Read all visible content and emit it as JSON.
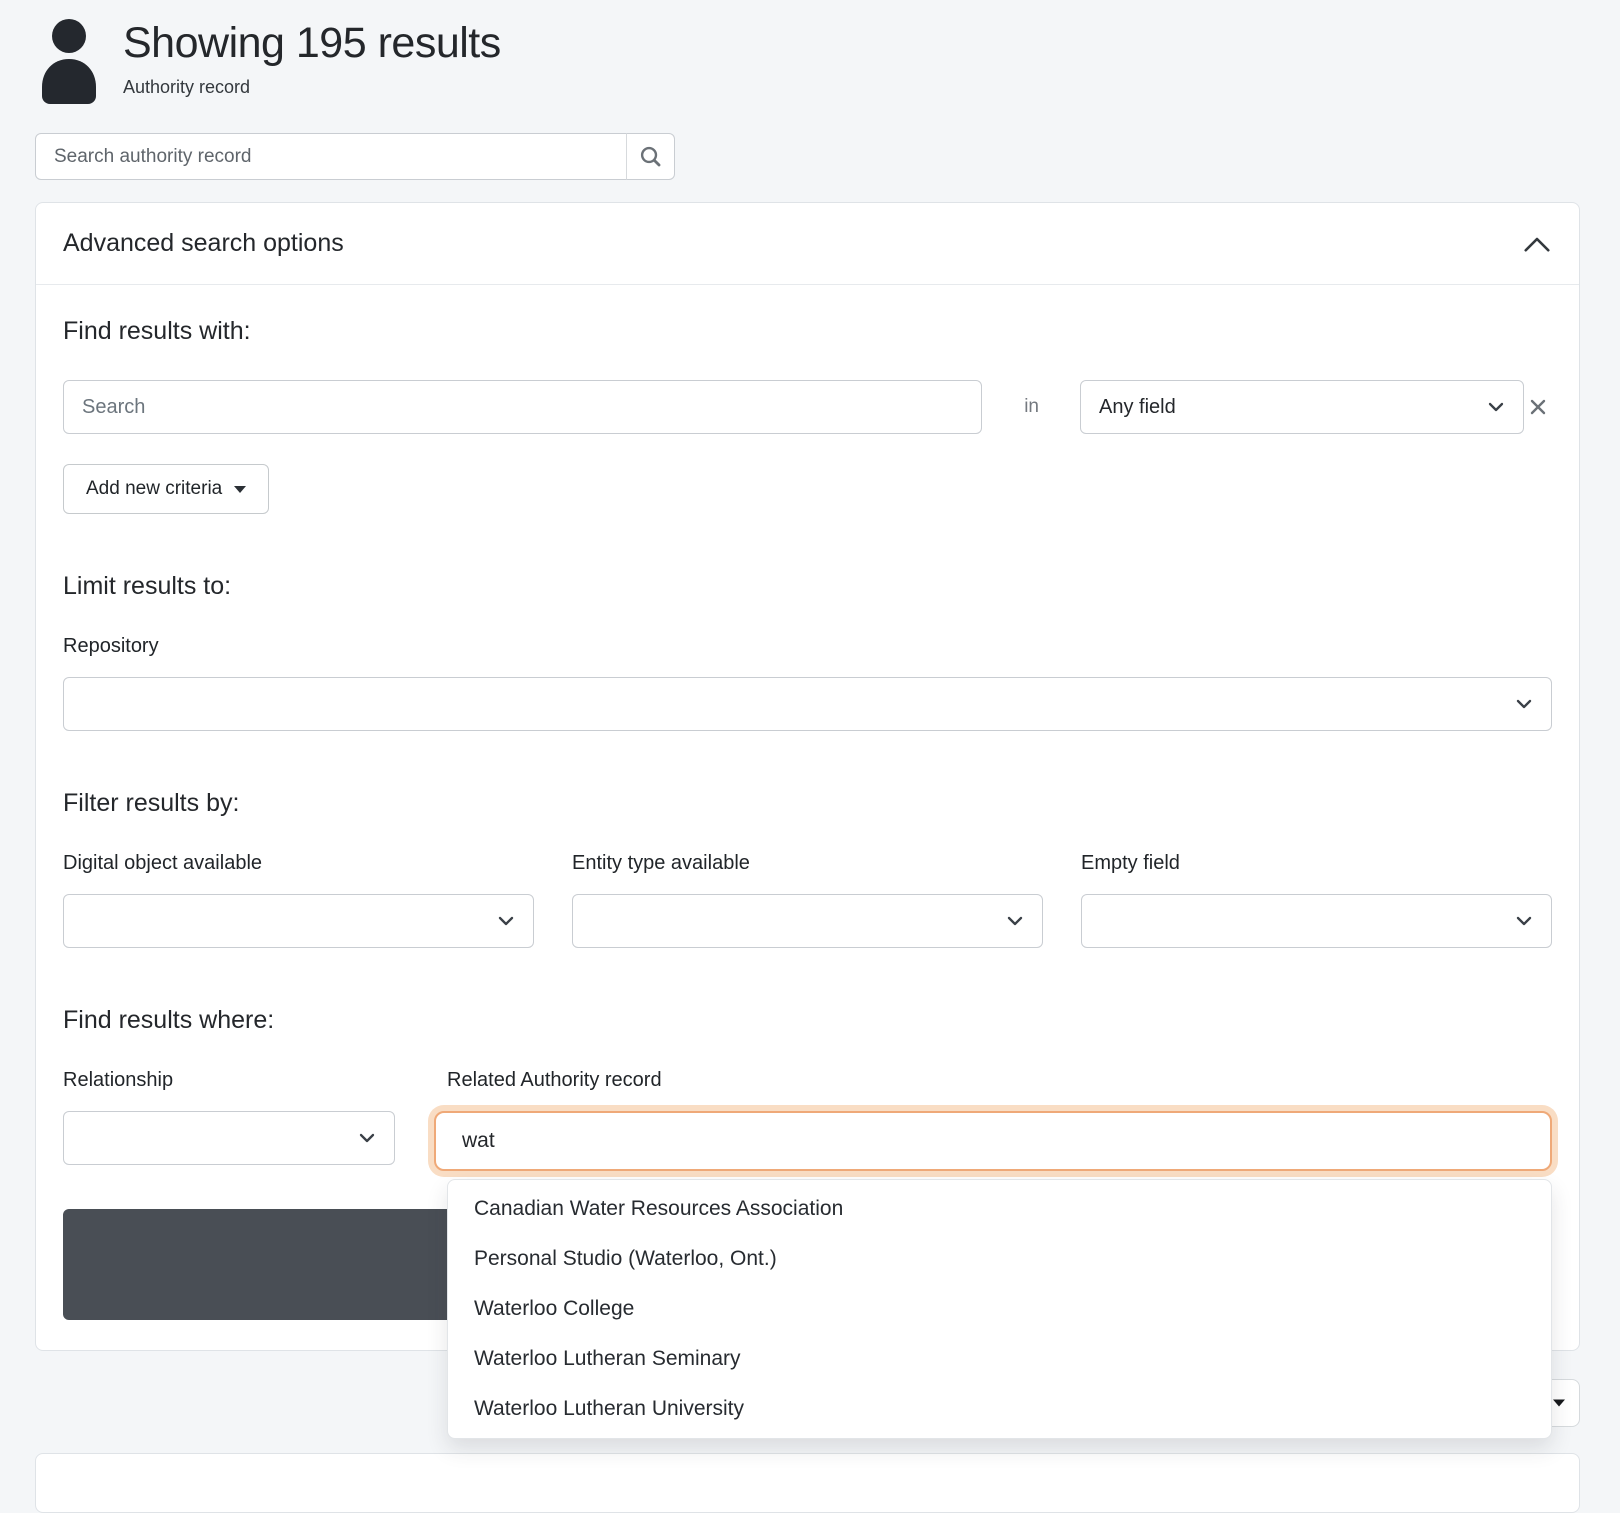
{
  "header": {
    "title": "Showing 195 results",
    "subtitle": "Authority record"
  },
  "search": {
    "placeholder": "Search authority record"
  },
  "advanced_search": {
    "title": "Advanced search options",
    "find_results_with": {
      "heading": "Find results with:",
      "search_placeholder": "Search",
      "in_label": "in",
      "field_select_value": "Any field",
      "add_criteria_label": "Add new criteria"
    },
    "limit_results": {
      "heading": "Limit results to:",
      "repository_label": "Repository",
      "repository_value": ""
    },
    "filter_results": {
      "heading": "Filter results by:",
      "filters": [
        {
          "label": "Digital object available",
          "value": ""
        },
        {
          "label": "Entity type available",
          "value": ""
        },
        {
          "label": "Empty field",
          "value": ""
        }
      ]
    },
    "find_results_where": {
      "heading": "Find results where:",
      "relationship_label": "Relationship",
      "relationship_value": "",
      "related_label": "Related Authority record",
      "related_value": "wat"
    }
  },
  "autocomplete": {
    "items": [
      "Canadian Water Resources Association",
      "Personal Studio (Waterloo, Ont.)",
      "Waterloo College",
      "Waterloo Lutheran Seminary",
      "Waterloo Lutheran University"
    ]
  },
  "colors": {
    "focus_border": "#efa978",
    "focus_glow": "#f9ddc4",
    "submit_button": "#494e55"
  }
}
